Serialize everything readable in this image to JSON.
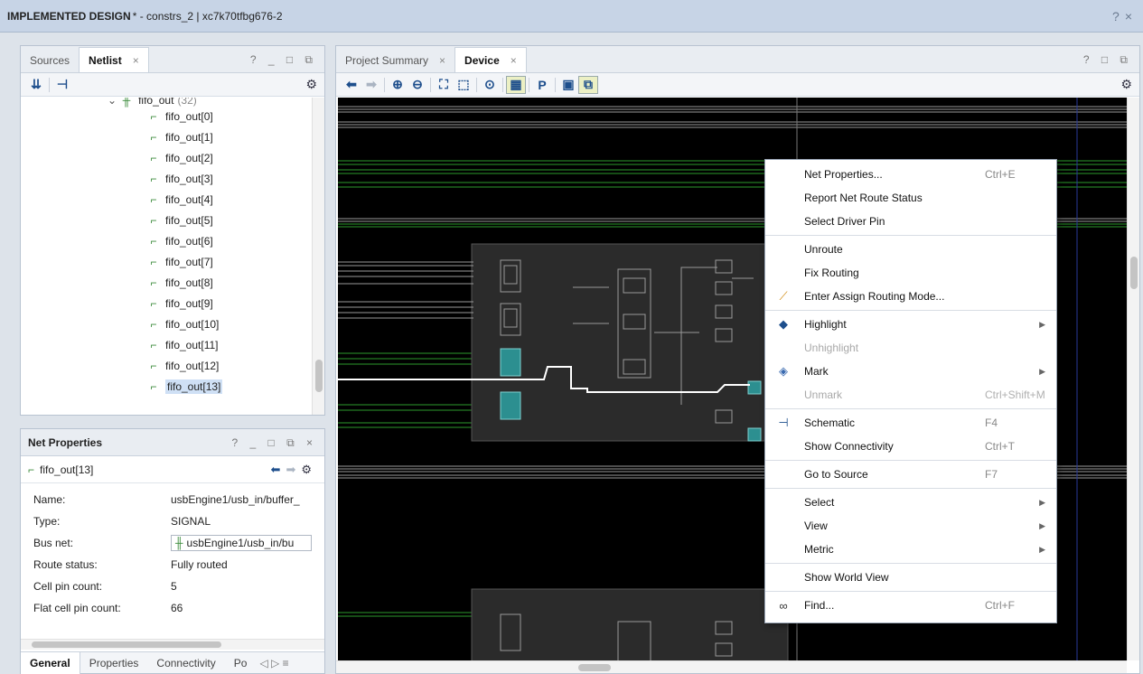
{
  "title": {
    "bold": "IMPLEMENTED DESIGN",
    "rest": " * - constrs_2 | xc7k70tfbg676-2",
    "help": "?",
    "close": "×"
  },
  "left_top": {
    "tabs": [
      "Sources",
      "Netlist"
    ],
    "tab_close": "×",
    "winbtns": "? _ □ ⧉",
    "tree_parent": {
      "label": "fifo_out",
      "count": "(32)"
    },
    "tree_items": [
      "fifo_out[0]",
      "fifo_out[1]",
      "fifo_out[2]",
      "fifo_out[3]",
      "fifo_out[4]",
      "fifo_out[5]",
      "fifo_out[6]",
      "fifo_out[7]",
      "fifo_out[8]",
      "fifo_out[9]",
      "fifo_out[10]",
      "fifo_out[11]",
      "fifo_out[12]",
      "fifo_out[13]"
    ]
  },
  "net_props": {
    "title": "Net Properties",
    "winbtns": "? _ □ ⧉ ×",
    "net": "fifo_out[13]",
    "rows": [
      {
        "k": "Name:",
        "v": "usbEngine1/usb_in/buffer_"
      },
      {
        "k": "Type:",
        "v": "SIGNAL"
      },
      {
        "k": "Bus net:",
        "v": "usbEngine1/usb_in/bu"
      },
      {
        "k": "Route status:",
        "v": "Fully routed"
      },
      {
        "k": "Cell pin count:",
        "v": "5"
      },
      {
        "k": "Flat cell pin count:",
        "v": "66"
      }
    ],
    "tabs": [
      "General",
      "Properties",
      "Connectivity",
      "Po"
    ],
    "tab_nav": "◁ ▷ ≡"
  },
  "device_panel": {
    "tabs": [
      "Project Summary",
      "Device"
    ],
    "tab_close": "×",
    "winbtns": "? □ ⧉"
  },
  "context_menu": [
    {
      "label": "Net Properties...",
      "shortcut": "Ctrl+E"
    },
    {
      "label": "Report Net Route Status"
    },
    {
      "label": "Select Driver Pin"
    },
    {
      "sep": true
    },
    {
      "label": "Unroute"
    },
    {
      "label": "Fix Routing"
    },
    {
      "label": "Enter Assign Routing Mode...",
      "icon": "assign-routing-icon"
    },
    {
      "sep": true
    },
    {
      "label": "Highlight",
      "submenu": true,
      "icon": "highlight-icon"
    },
    {
      "label": "Unhighlight",
      "disabled": true
    },
    {
      "label": "Mark",
      "submenu": true,
      "icon": "mark-icon"
    },
    {
      "label": "Unmark",
      "shortcut": "Ctrl+Shift+M",
      "disabled": true
    },
    {
      "sep": true
    },
    {
      "label": "Schematic",
      "shortcut": "F4",
      "icon": "schematic-icon"
    },
    {
      "label": "Show Connectivity",
      "shortcut": "Ctrl+T"
    },
    {
      "sep": true
    },
    {
      "label": "Go to Source",
      "shortcut": "F7"
    },
    {
      "sep": true
    },
    {
      "label": "Select",
      "submenu": true
    },
    {
      "label": "View",
      "submenu": true
    },
    {
      "label": "Metric",
      "submenu": true
    },
    {
      "sep": true
    },
    {
      "label": "Show World View"
    },
    {
      "sep": true
    },
    {
      "label": "Find...",
      "shortcut": "Ctrl+F",
      "icon": "binoculars-icon"
    }
  ]
}
